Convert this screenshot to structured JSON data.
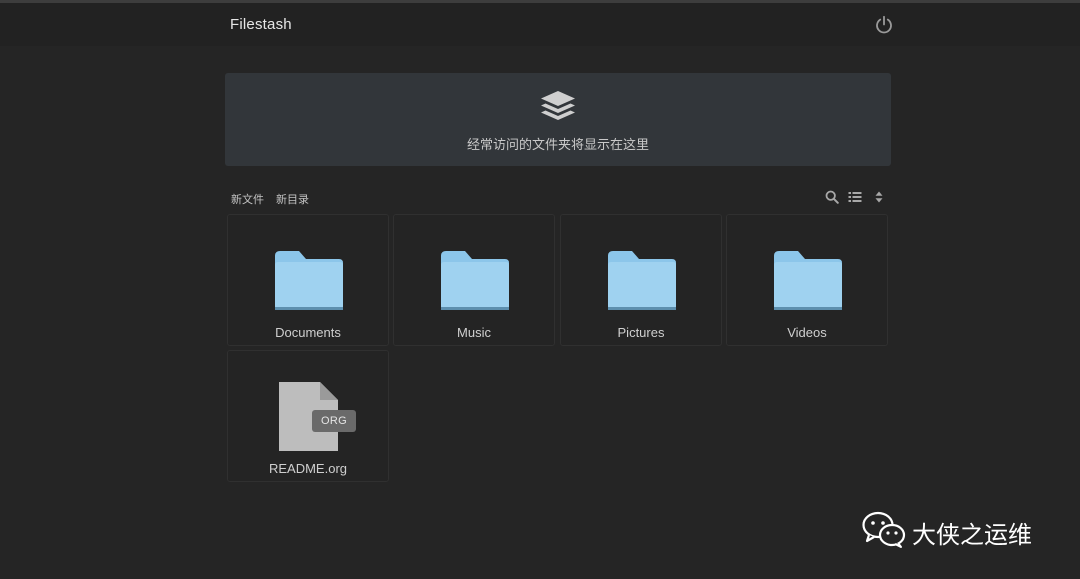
{
  "header": {
    "title": "Filestash",
    "power_icon": "power-icon"
  },
  "banner": {
    "icon": "layers-icon",
    "text": "经常访问的文件夹将显示在这里"
  },
  "toolbar": {
    "new_file": "新文件",
    "new_folder": "新目录",
    "icons": [
      "search-icon",
      "list-view-icon",
      "sort-icon"
    ]
  },
  "files": [
    {
      "name": "Documents",
      "type": "folder"
    },
    {
      "name": "Music",
      "type": "folder"
    },
    {
      "name": "Pictures",
      "type": "folder"
    },
    {
      "name": "Videos",
      "type": "folder"
    },
    {
      "name": "README.org",
      "type": "file",
      "badge": "ORG"
    }
  ],
  "watermark": {
    "icon": "wechat-icon",
    "text": "大侠之运维"
  },
  "colors": {
    "background": "#252525",
    "header": "#222222",
    "banner": "#32363a",
    "folder": "#9fd2f0",
    "folder_tab": "#8cc6ea",
    "file": "#bdbdbd"
  }
}
